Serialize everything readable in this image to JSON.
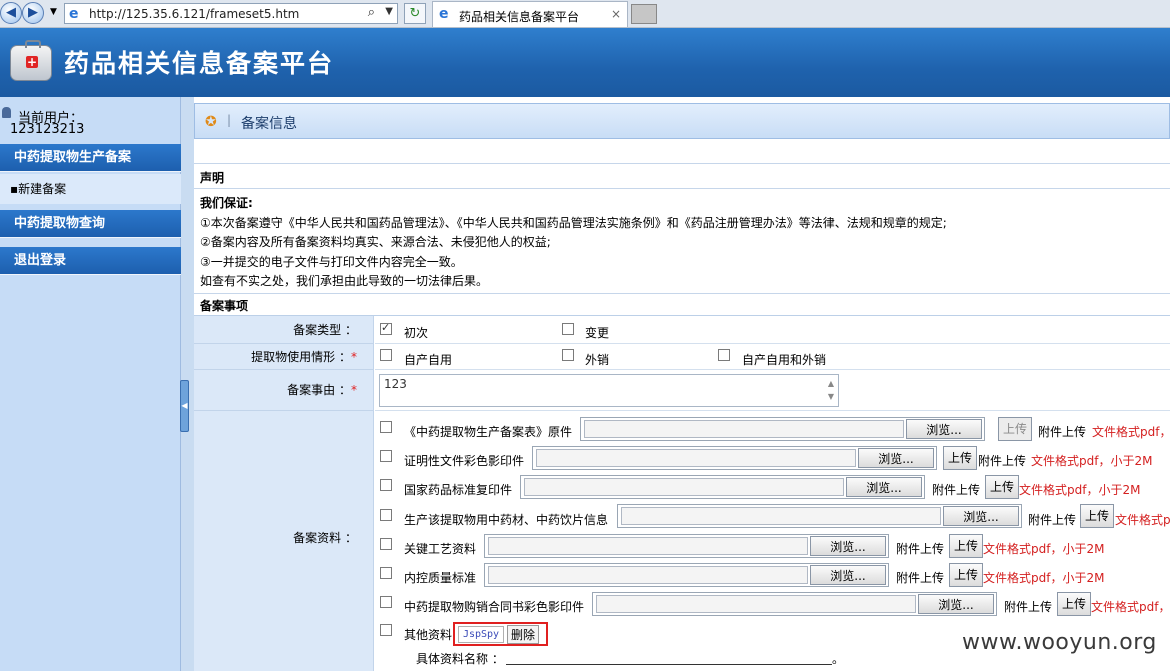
{
  "browser": {
    "url": "http://125.35.6.121/frameset5.htm",
    "tab_title": "药品相关信息备案平台",
    "close_glyph": "×"
  },
  "banner": {
    "title": "药品相关信息备案平台"
  },
  "sidebar": {
    "user_label": "当前用户：",
    "user_id": "123123213",
    "sections": [
      {
        "label": "中药提取物生产备案"
      },
      {
        "label": "中药提取物查询"
      },
      {
        "label": "退出登录"
      }
    ],
    "items": [
      {
        "label": "▪新建备案"
      }
    ]
  },
  "main": {
    "panel_title": "备案信息",
    "declaration_title": "声明",
    "guarantee_title": "我们保证:",
    "guarantee_lines": [
      "①本次备案遵守《中华人民共和国药品管理法》、《中华人民共和国药品管理法实施条例》和《药品注册管理办法》等法律、法规和规章的规定;",
      "②备案内容及所有备案资料均真实、来源合法、未侵犯他人的权益;",
      "③一并提交的电子文件与打印文件内容完全一致。",
      "如查有不实之处，我们承担由此导致的一切法律后果。"
    ],
    "filing_title": "备案事项"
  },
  "form": {
    "filing_type": {
      "label": "备案类型 ：",
      "options": [
        {
          "label": "初次",
          "checked": true
        },
        {
          "label": "变更",
          "checked": false
        }
      ]
    },
    "usage": {
      "label": "提取物使用情形 ：",
      "required_mark": "*",
      "options": [
        {
          "label": "自产自用",
          "checked": false
        },
        {
          "label": "外销",
          "checked": false
        },
        {
          "label": "自产自用和外销",
          "checked": false
        }
      ]
    },
    "reason": {
      "label": "备案事由 ：",
      "required_mark": "*",
      "value": "123"
    },
    "materials": {
      "label": "备案资料 ：",
      "browse_label": "浏览...",
      "upload_label": "上传",
      "attach_note": "附件上传",
      "items": [
        {
          "label": "《中药提取物生产备案表》原件",
          "format": "文件格式pdf，",
          "upload_disabled": true
        },
        {
          "label": "证明性文件彩色影印件",
          "format": "文件格式pdf，小于2M",
          "upload_disabled": false
        },
        {
          "label": "国家药品标准复印件",
          "format": "文件格式pdf，小于2M",
          "upload_disabled": false
        },
        {
          "label": "生产该提取物用中药材、中药饮片信息",
          "format": "文件格式p",
          "upload_disabled": false
        },
        {
          "label": "关键工艺资料",
          "format": "文件格式pdf，小于2M",
          "upload_disabled": false
        },
        {
          "label": "内控质量标准",
          "format": "文件格式pdf，小于2M",
          "upload_disabled": false
        },
        {
          "label": "中药提取物购销合同书彩色影印件",
          "format": "文件格式pdf，",
          "upload_disabled": false
        }
      ],
      "other": {
        "label": "其他资料",
        "file_tag": "JspSpy",
        "delete_label": "删除",
        "detail_label": "具体资料名称 ：",
        "detail_end": "。"
      }
    }
  },
  "watermark": "www.wooyun.org",
  "colors": {
    "banner": "#1f62ad",
    "sidebar_head": "#2c78cc",
    "label_bg": "#dbe8f8",
    "format_note": "#d42020",
    "highlight": "#e02020"
  }
}
